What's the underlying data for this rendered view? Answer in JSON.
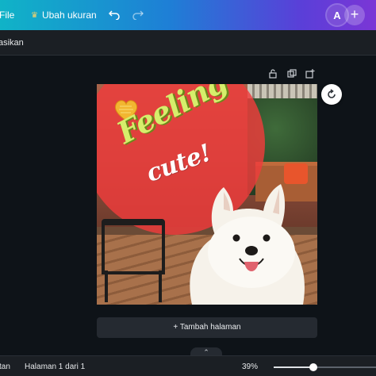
{
  "topbar": {
    "file_label": "File",
    "resize_label": "Ubah ukuran",
    "undo_icon": "undo-icon",
    "redo_icon": "redo-icon",
    "avatar_initial": "A",
    "add_label": "+"
  },
  "subbar": {
    "label": "asikan"
  },
  "design": {
    "line1": "Feeling",
    "line2": "cute!"
  },
  "canvas": {
    "add_page_label": "+ Tambah halaman"
  },
  "statusbar": {
    "notes_label": "tan",
    "pages_label": "Halaman 1 dari 1",
    "zoom_label": "39%",
    "zoom_fraction": 0.39
  },
  "colors": {
    "topbar_start": "#10b3c7",
    "topbar_end": "#7b36d6",
    "editor_bg": "#0e1318",
    "panel_bg": "#1b1f24"
  }
}
